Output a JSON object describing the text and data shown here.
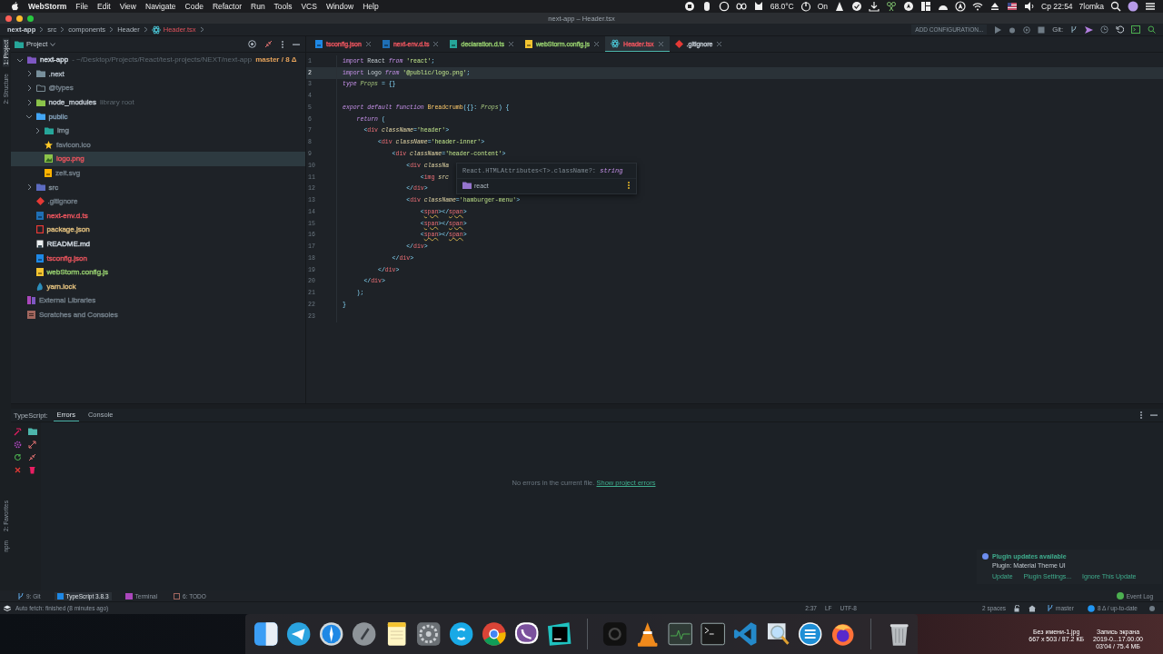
{
  "menu_bar": {
    "app": "WebStorm",
    "menus": [
      "File",
      "Edit",
      "View",
      "Navigate",
      "Code",
      "Refactor",
      "Run",
      "Tools",
      "VCS",
      "Window",
      "Help"
    ],
    "temperature": "68.0°C",
    "power_status": "On",
    "clock": "Ср 22:54",
    "user": "7lomka"
  },
  "window": {
    "title": "next-app – Header.tsx"
  },
  "breadcrumb": [
    {
      "label": "next-app",
      "kind": "project"
    },
    {
      "label": "src",
      "kind": "folder"
    },
    {
      "label": "components",
      "kind": "folder"
    },
    {
      "label": "Header",
      "kind": "folder"
    },
    {
      "label": "Header.tsx",
      "kind": "react-file"
    }
  ],
  "toolbar": {
    "run_config": "ADD CONFIGURATION...",
    "vcs_label": "Git:"
  },
  "tool_stripe": {
    "top": [
      {
        "label": "1: Project",
        "selected": true
      },
      {
        "label": "2: Structure",
        "selected": false
      }
    ],
    "bottom": [
      {
        "label": "2: Favorites",
        "selected": false
      },
      {
        "label": "npm",
        "selected": false
      }
    ]
  },
  "project_panel": {
    "title": "Project",
    "tree": [
      {
        "label": "next-app",
        "path": "- ~/Desktop/Projects/React/test-projects/NEXT/next-app",
        "branch": "master / 8 Δ",
        "kind": "folder-project",
        "color": "#c9d1d9",
        "expanded": true,
        "selected": false,
        "children": [
          {
            "label": ".next",
            "kind": "folder",
            "color": "#a9b3bd",
            "expanded": false,
            "selected": false
          },
          {
            "label": "@types",
            "kind": "folder-outline",
            "color": "#6f7b85",
            "expanded": false,
            "selected": false
          },
          {
            "label": "node_modules",
            "hint": "library root",
            "kind": "folder-lib",
            "color": "#b8c0c8",
            "expanded": false,
            "selected": false
          },
          {
            "label": "public",
            "kind": "folder-web",
            "color": "#7f9bb3",
            "expanded": true,
            "selected": false,
            "children": [
              {
                "label": "img",
                "kind": "folder-res",
                "color": "#7f8c96",
                "expanded": false,
                "selected": false
              },
              {
                "label": "favicon.ico",
                "kind": "favicon",
                "color": "#6f7b85",
                "selected": false
              },
              {
                "label": "logo.png",
                "kind": "image",
                "color": "#e0525b",
                "selected": true
              },
              {
                "label": "zelt.svg",
                "kind": "svg",
                "color": "#6f7b85",
                "selected": false
              }
            ]
          },
          {
            "label": "src",
            "kind": "folder-src",
            "color": "#7f8c96",
            "expanded": false,
            "selected": false
          },
          {
            "label": ".gitignore",
            "kind": "gitignore",
            "color": "#6f7b85",
            "selected": false
          },
          {
            "label": "next-env.d.ts",
            "kind": "ts",
            "color": "#e0525b",
            "selected": false
          },
          {
            "label": "package.json",
            "kind": "npm",
            "color": "#d8b87a",
            "selected": false
          },
          {
            "label": "README.md",
            "kind": "readme",
            "color": "#c9d1d9",
            "selected": false
          },
          {
            "label": "tsconfig.json",
            "kind": "tsconfig",
            "color": "#e0525b",
            "selected": false
          },
          {
            "label": "webStorm.config.js",
            "kind": "js",
            "color": "#8fc46a",
            "selected": false
          },
          {
            "label": "yarn.lock",
            "kind": "yarn",
            "color": "#d8b87a",
            "selected": false
          }
        ]
      },
      {
        "label": "External Libraries",
        "kind": "library",
        "color": "#6f7b85",
        "selected": false
      },
      {
        "label": "Scratches and Consoles",
        "kind": "scratch",
        "color": "#6f7b85",
        "selected": false
      }
    ]
  },
  "tabs": [
    {
      "label": "tsconfig.json",
      "kind": "tsconfig",
      "color": "#e0525b",
      "selected": false
    },
    {
      "label": "next-env.d.ts",
      "kind": "ts",
      "color": "#e0525b",
      "selected": false
    },
    {
      "label": "declaration.d.ts",
      "kind": "ts-decl",
      "color": "#8fc46a",
      "selected": false
    },
    {
      "label": "webStorm.config.js",
      "kind": "js",
      "color": "#8fc46a",
      "selected": false
    },
    {
      "label": "Header.tsx",
      "kind": "react",
      "color": "#e0525b",
      "selected": true
    },
    {
      "label": ".gitignore",
      "kind": "gitignore",
      "color": "#b8c0c8",
      "selected": false
    }
  ],
  "editor": {
    "lines": [
      {
        "number": "1",
        "current": false,
        "tokens": [
          {
            "kind": "keyword",
            "text": "import"
          },
          {
            "kind": "plain",
            "text": " React "
          },
          {
            "kind": "keyword-italic",
            "text": "from"
          },
          {
            "kind": "string",
            "text": " 'react'"
          },
          {
            "kind": "punct",
            "text": ";"
          }
        ]
      },
      {
        "number": "2",
        "current": true,
        "tokens": [
          {
            "kind": "keyword",
            "text": "import"
          },
          {
            "kind": "plain",
            "text": " Logo "
          },
          {
            "kind": "keyword-italic",
            "text": "from"
          },
          {
            "kind": "string",
            "text": " '@public/logo.png'"
          },
          {
            "kind": "punct",
            "text": ";"
          }
        ]
      },
      {
        "number": "3",
        "current": false,
        "tokens": [
          {
            "kind": "keyword-italic",
            "text": "type"
          },
          {
            "kind": "type",
            "text": " Props"
          },
          {
            "kind": "punct",
            "text": " = {}"
          }
        ]
      },
      {
        "number": "4",
        "current": false
      },
      {
        "number": "5",
        "current": false,
        "tokens": [
          {
            "kind": "keyword-italic",
            "text": "export default function"
          },
          {
            "kind": "function",
            "text": " Breadcrumb"
          },
          {
            "kind": "punct",
            "text": "({}: "
          },
          {
            "kind": "type",
            "text": "Props"
          },
          {
            "kind": "punct",
            "text": ") {"
          }
        ]
      },
      {
        "number": "6",
        "current": false,
        "tokens": [
          {
            "kind": "keyword-italic",
            "text": "    return"
          },
          {
            "kind": "punct",
            "text": " ("
          }
        ]
      },
      {
        "number": "7",
        "current": false,
        "tokens": [
          {
            "kind": "punct",
            "text": "      <"
          },
          {
            "kind": "tag",
            "text": "div"
          },
          {
            "kind": "attr",
            "text": " className"
          },
          {
            "kind": "punct",
            "text": "="
          },
          {
            "kind": "string",
            "text": "'header'"
          },
          {
            "kind": "punct",
            "text": ">"
          }
        ]
      },
      {
        "number": "8",
        "current": false,
        "tokens": [
          {
            "kind": "punct",
            "text": "          <"
          },
          {
            "kind": "tag",
            "text": "div"
          },
          {
            "kind": "attr",
            "text": " className"
          },
          {
            "kind": "punct",
            "text": "="
          },
          {
            "kind": "string",
            "text": "'header-inner'"
          },
          {
            "kind": "punct",
            "text": ">"
          }
        ]
      },
      {
        "number": "9",
        "current": false,
        "tokens": [
          {
            "kind": "punct",
            "text": "              <"
          },
          {
            "kind": "tag",
            "text": "div"
          },
          {
            "kind": "attr",
            "text": " className"
          },
          {
            "kind": "punct",
            "text": "="
          },
          {
            "kind": "string",
            "text": "'header-content'"
          },
          {
            "kind": "punct",
            "text": ">"
          }
        ]
      },
      {
        "number": "10",
        "current": false,
        "tokens": [
          {
            "kind": "punct",
            "text": "                  <"
          },
          {
            "kind": "tag",
            "text": "div"
          },
          {
            "kind": "attr",
            "text": " classNa"
          }
        ]
      },
      {
        "number": "11",
        "current": false,
        "tokens": [
          {
            "kind": "punct",
            "text": "                      <"
          },
          {
            "kind": "tag",
            "text": "img"
          },
          {
            "kind": "attr",
            "text": " src"
          }
        ]
      },
      {
        "number": "12",
        "current": false,
        "tokens": [
          {
            "kind": "punct",
            "text": "                  </"
          },
          {
            "kind": "tag",
            "text": "div"
          },
          {
            "kind": "punct",
            "text": ">"
          }
        ]
      },
      {
        "number": "13",
        "current": false,
        "tokens": [
          {
            "kind": "punct",
            "text": "                  <"
          },
          {
            "kind": "tag",
            "text": "div"
          },
          {
            "kind": "attr",
            "text": " className"
          },
          {
            "kind": "punct",
            "text": "="
          },
          {
            "kind": "string",
            "text": "'hamburger-menu'"
          },
          {
            "kind": "punct",
            "text": ">"
          }
        ]
      },
      {
        "number": "14",
        "current": false,
        "tokens": [
          {
            "kind": "punct",
            "text": "                      <"
          },
          {
            "kind": "tag-unresolved",
            "text": "span"
          },
          {
            "kind": "punct",
            "text": "></"
          },
          {
            "kind": "tag-unresolved",
            "text": "span"
          },
          {
            "kind": "punct",
            "text": ">"
          }
        ]
      },
      {
        "number": "15",
        "current": false,
        "tokens": [
          {
            "kind": "punct",
            "text": "                      <"
          },
          {
            "kind": "tag-unresolved",
            "text": "span"
          },
          {
            "kind": "punct",
            "text": "></"
          },
          {
            "kind": "tag-unresolved",
            "text": "span"
          },
          {
            "kind": "punct",
            "text": ">"
          }
        ]
      },
      {
        "number": "16",
        "current": false,
        "tokens": [
          {
            "kind": "punct",
            "text": "                      <"
          },
          {
            "kind": "tag-unresolved",
            "text": "span"
          },
          {
            "kind": "punct",
            "text": "></"
          },
          {
            "kind": "tag-unresolved",
            "text": "span"
          },
          {
            "kind": "punct",
            "text": ">"
          }
        ]
      },
      {
        "number": "17",
        "current": false,
        "tokens": [
          {
            "kind": "punct",
            "text": "                  </"
          },
          {
            "kind": "tag",
            "text": "div"
          },
          {
            "kind": "punct",
            "text": ">"
          }
        ]
      },
      {
        "number": "18",
        "current": false,
        "tokens": [
          {
            "kind": "punct",
            "text": "              </"
          },
          {
            "kind": "tag",
            "text": "div"
          },
          {
            "kind": "punct",
            "text": ">"
          }
        ]
      },
      {
        "number": "19",
        "current": false,
        "tokens": [
          {
            "kind": "punct",
            "text": "          </"
          },
          {
            "kind": "tag",
            "text": "div"
          },
          {
            "kind": "punct",
            "text": ">"
          }
        ]
      },
      {
        "number": "20",
        "current": false,
        "tokens": [
          {
            "kind": "punct",
            "text": "      </"
          },
          {
            "kind": "tag",
            "text": "div"
          },
          {
            "kind": "punct",
            "text": ">"
          }
        ]
      },
      {
        "number": "21",
        "current": false,
        "tokens": [
          {
            "kind": "punct",
            "text": "    );"
          }
        ]
      },
      {
        "number": "22",
        "current": false,
        "tokens": [
          {
            "kind": "punct",
            "text": "}"
          }
        ]
      },
      {
        "number": "23",
        "current": false
      }
    ],
    "quick_doc": {
      "signature": "React.HTMLAttributes<T>.className?:",
      "type": "string",
      "module": "react"
    }
  },
  "bottom_panel": {
    "label": "TypeScript:",
    "tabs": [
      {
        "label": "Errors",
        "selected": true
      },
      {
        "label": "Console",
        "selected": false
      }
    ],
    "message": "No errors in the current file.",
    "link": "Show project errors"
  },
  "notification": {
    "title": "Plugin updates available",
    "body": "Plugin: Material Theme UI",
    "actions": [
      "Update",
      "Plugin Settings...",
      "Ignore This Update"
    ]
  },
  "tool_windows": [
    {
      "label": "9: Git",
      "kind": "git",
      "selected": false
    },
    {
      "label": "TypeScript 3.8.3",
      "kind": "ts",
      "selected": true
    },
    {
      "label": "Terminal",
      "kind": "terminal",
      "selected": false
    },
    {
      "label": "6: TODO",
      "kind": "todo",
      "selected": false
    }
  ],
  "event_log": "Event Log",
  "status_bar": {
    "message": "Auto fetch: finished (8 minutes ago)",
    "position": "2:37",
    "line_separator": "LF",
    "encoding": "UTF-8",
    "indent": "2 spaces",
    "branch": "master",
    "vcs_status": "8 Δ / up-to-date"
  },
  "desktop_files": [
    {
      "name": "Без имени-1.jpg",
      "details": [
        "667 x 503 / 87.2 КБ"
      ]
    },
    {
      "name": "Запись экрана",
      "details": [
        "2019-0...17.00.00",
        "03'04 / 75.4 МБ"
      ]
    }
  ]
}
